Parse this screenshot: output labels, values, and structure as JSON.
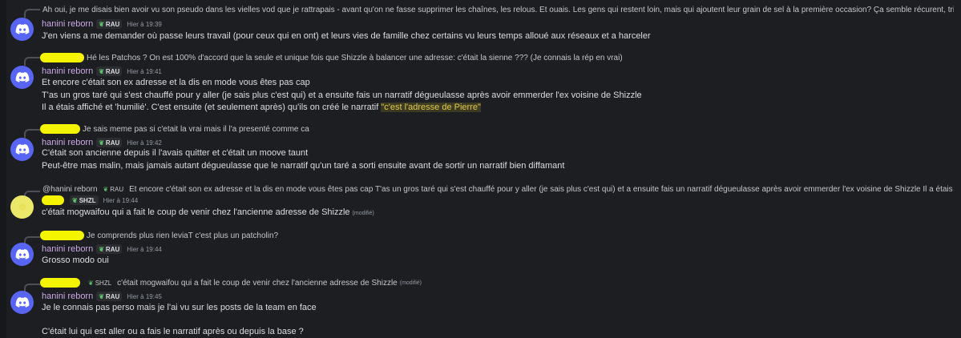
{
  "messages": [
    {
      "reply_text": "Ah oui, je me disais bien avoir vu son pseudo dans les vielles vod que je rattrapais - avant qu'on ne fasse supprimer les chaînes, les relous.  Et ouais. Les gens qui restent loin, mais qui ajoutent leur grain de sel à la première occasion? Ça semble récurent, tristement. T...",
      "author": "hanini reborn",
      "tag": "RAU",
      "time": "Hier à 19:39",
      "lines": [
        "J'en viens a me demander où passe leurs travail (pour ceux qui en ont) et leurs vies de famille chez certains vu leurs temps alloué aux réseaux et a harceler"
      ]
    },
    {
      "reply_text": "Hé les Patchos ? On est 100% d'accord que la seule et unique fois que Shizzle à balancer une adresse: c'était la sienne ??? (Je connais la rép en vrai)",
      "author": "hanini reborn",
      "tag": "RAU",
      "time": "Hier à 19:41",
      "lines": [
        "Et encore c'était son ex adresse et la dis en mode vous êtes pas cap",
        "T'as un gros taré qui s'est chauffé pour y aller (je sais plus c'est qui) et a ensuite fais un narratif dégueulasse après avoir emmerder l'ex voisine de Shizzle",
        "Il a étais affiché et 'humilié'. C'est ensuite (et seulement après) qu'ils on créé le narratif "
      ],
      "highlight": "\"c'est l'adresse de Pierre\""
    },
    {
      "reply_text": "Je sais meme pas si c'etait la vrai mais il l'a presenté comme ca",
      "author": "hanini reborn",
      "tag": "RAU",
      "time": "Hier à 19:42",
      "lines": [
        "C'était son ancienne depuis il l'avais quitter et c'était un moove taunt",
        "Peut-être mas malin, mais jamais autant dégueulasse que le narratif qu'un taré a sorti ensuite avant de sortir un narratif bien diffamant"
      ]
    },
    {
      "reply_author": "@hanini reborn",
      "reply_tag": "RAU",
      "reply_text": "Et encore c'était son ex adresse et la dis en mode vous êtes pas cap T'as un gros taré qui s'est chauffé pour y aller (je sais plus c'est qui) et a ensuite fais un narratif dégueulasse après avoir emmerder l'ex voisine de Shizzle  Il a étais affiché et 'humilié'. C'e...",
      "tag": "SHZL",
      "time": "Hier à 19:44",
      "lines": [
        "c'était mogwaifou qui a fait le coup de venir chez l'ancienne adresse de Shizzle"
      ],
      "edited": "(modifié)"
    },
    {
      "reply_text": "Je comprends plus rien leviaT c'est plus un patcholin?",
      "author": "hanini reborn",
      "tag": "RAU",
      "time": "Hier à 19:44",
      "lines": [
        "Grosso modo oui"
      ]
    },
    {
      "reply_tag": "SHZL",
      "reply_text": "c'était mogwaifou qui a fait le coup de venir chez l'ancienne adresse de Shizzle",
      "reply_edited": "(modifié)",
      "author": "hanini reborn",
      "tag": "RAU",
      "time": "Hier à 19:45",
      "lines": [
        "Je le connais pas perso mais je l'ai vu sur les posts de la team en face",
        "",
        "C'était lui qui est aller ou a fais le narratif après ou depuis la base ?"
      ]
    }
  ],
  "icons": {
    "avatar": "discord-logo-icon",
    "tag": "leaf-icon"
  },
  "colors": {
    "background": "#1d1e22",
    "username": "#c9a8e6",
    "highlight": "#e6c84a",
    "redaction": "#f4f400",
    "avatar": "#5865f2"
  }
}
